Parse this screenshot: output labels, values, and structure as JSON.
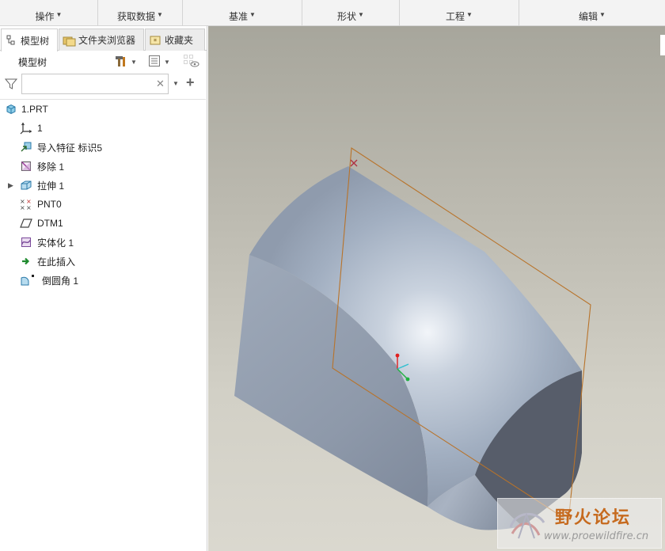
{
  "ribbon": {
    "groups": [
      {
        "label": "操作"
      },
      {
        "label": "获取数据"
      },
      {
        "label": "基准"
      },
      {
        "label": "形状"
      },
      {
        "label": "工程"
      },
      {
        "label": "编辑"
      }
    ]
  },
  "left_panel": {
    "tabs": [
      {
        "label": "模型树",
        "active": true
      },
      {
        "label": "文件夹浏览器",
        "active": false
      },
      {
        "label": "收藏夹",
        "active": false
      }
    ],
    "tree_title": "模型树",
    "filter": {
      "value": "",
      "placeholder": ""
    },
    "tree": [
      {
        "label": "1.PRT",
        "icon": "part-icon"
      },
      {
        "label": "1",
        "icon": "csys-icon"
      },
      {
        "label": "导入特征 标识5",
        "icon": "import-feature-icon"
      },
      {
        "label": "移除 1",
        "icon": "remove-icon"
      },
      {
        "label": "拉伸 1",
        "icon": "extrude-icon",
        "expandable": true
      },
      {
        "label": "PNT0",
        "icon": "datum-point-icon"
      },
      {
        "label": "DTM1",
        "icon": "datum-plane-icon"
      },
      {
        "label": "实体化 1",
        "icon": "solidify-icon"
      },
      {
        "label": "在此插入",
        "icon": "insert-here-arrow-icon"
      },
      {
        "label": "倒圆角 1",
        "icon": "round-icon"
      }
    ]
  },
  "watermark": {
    "title": "野火论坛",
    "url": "www.proewildfire.cn"
  },
  "colors": {
    "viewport_top": "#a7a69c",
    "viewport_bottom": "#dad8cf",
    "model_body": "#9aa6b8",
    "model_dark_face": "#575d6a",
    "datum_plane": "#b8732a",
    "csys_red": "#e02020",
    "csys_green": "#20b040",
    "csys_cyan": "#30c0d0"
  }
}
